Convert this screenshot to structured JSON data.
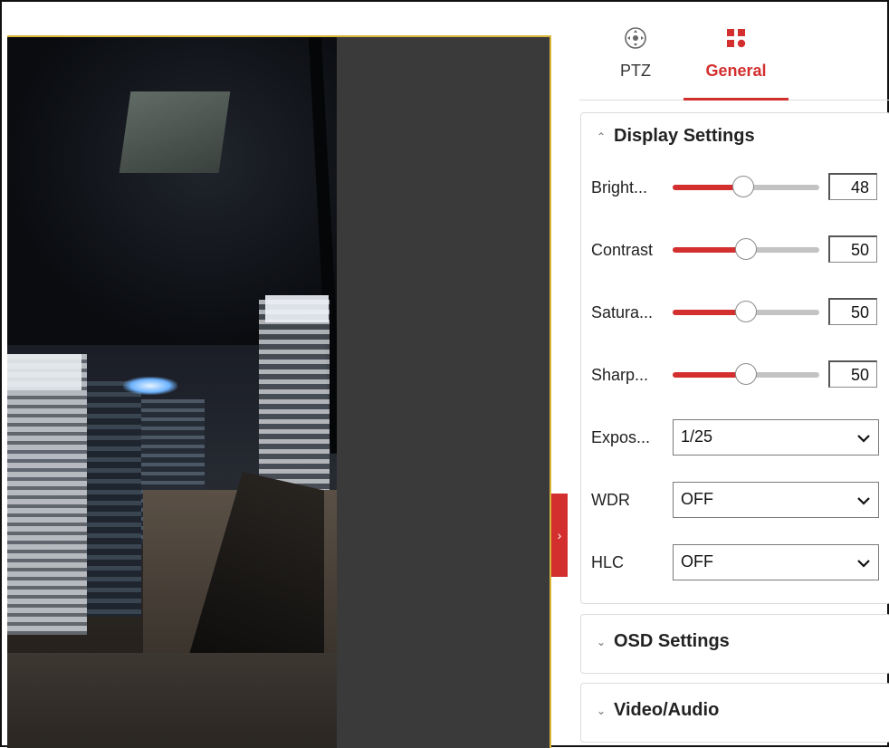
{
  "tabs": [
    {
      "label": "PTZ",
      "icon": "ptz-icon"
    },
    {
      "label": "General",
      "icon": "grid-icon",
      "active": true
    }
  ],
  "display_settings": {
    "title": "Display Settings",
    "expanded": true,
    "sliders": [
      {
        "label": "Bright...",
        "value": "48",
        "level": 48
      },
      {
        "label": "Contrast",
        "value": "50",
        "level": 50
      },
      {
        "label": "Satura...",
        "value": "50",
        "level": 50
      },
      {
        "label": "Sharp...",
        "value": "50",
        "level": 50
      }
    ],
    "selects": [
      {
        "label": "Expos...",
        "value": "1/25"
      },
      {
        "label": "WDR",
        "value": "OFF"
      },
      {
        "label": "HLC",
        "value": "OFF"
      }
    ]
  },
  "osd_settings": {
    "title": "OSD Settings",
    "expanded": false
  },
  "video_audio": {
    "title": "Video/Audio",
    "expanded": false
  },
  "colors": {
    "accent": "#d32f2f",
    "track": "#c3c3c3",
    "video_bg": "#3a3a3a",
    "video_border": "#d9b63a"
  }
}
